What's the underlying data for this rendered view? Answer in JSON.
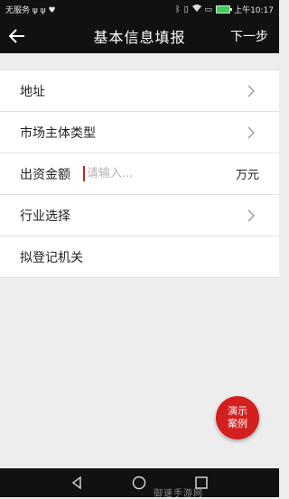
{
  "status_bar": {
    "carrier": "无服务 ψ ψ ♥",
    "time": "上午10:17"
  },
  "header": {
    "title": "基本信息填报",
    "next_label": "下一步"
  },
  "form": {
    "address_label": "地址",
    "entity_type_label": "市场主体类型",
    "capital_label": "出资金额",
    "capital_placeholder": "请输入...",
    "capital_unit": "万元",
    "industry_label": "行业选择",
    "registrar_label": "拟登记机关"
  },
  "fab": {
    "line1": "演示",
    "line2": "案例"
  },
  "watermark": "御速手游网",
  "colors": {
    "bar_bg": "#111111",
    "accent_red": "#d41f1f",
    "page_bg": "#ededed"
  }
}
